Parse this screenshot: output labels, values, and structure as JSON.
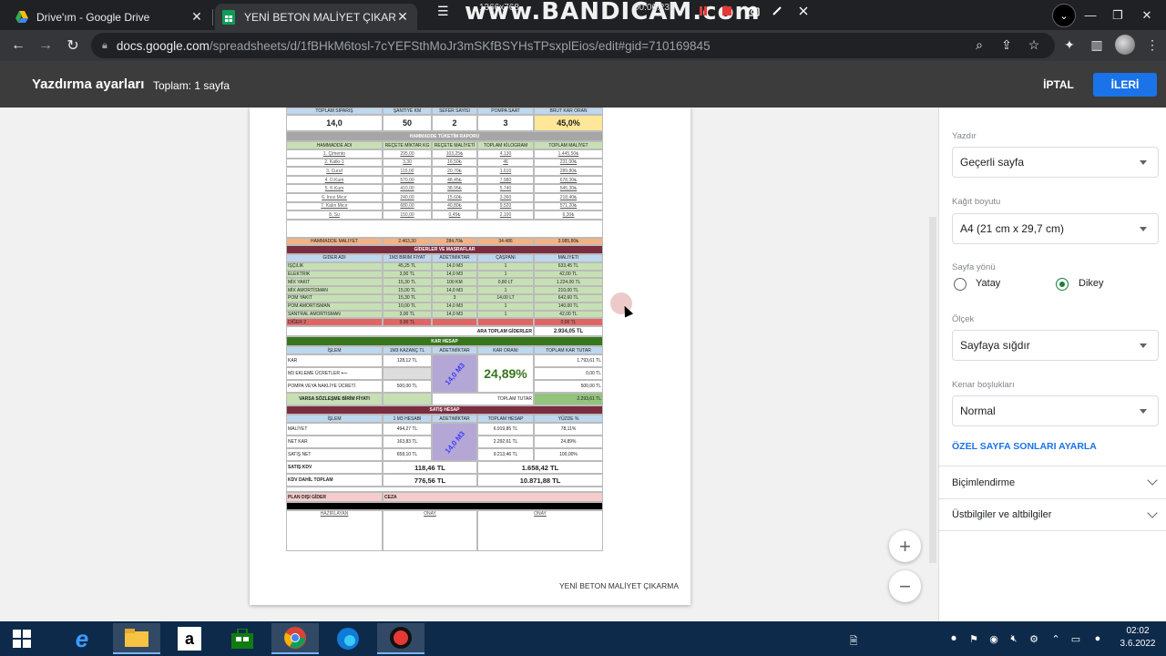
{
  "tabs": [
    {
      "title": "Drive'ım - Google Drive",
      "icon": "google-drive-icon"
    },
    {
      "title": "YENİ BETON MALİYET ÇIKARMA",
      "icon": "google-sheets-icon"
    }
  ],
  "recorder": {
    "logo": "www.BANDICAM.com",
    "resolution": "1366x768",
    "time": "00:06:231"
  },
  "address": {
    "host": "docs.google.com",
    "path": "/spreadsheets/d/1fBHkM6tosl-7cYEFSthMoJr3mSKfBSYHsTPsxplEios/edit#gid=710169845"
  },
  "print": {
    "title": "Yazdırma ayarları",
    "total": "Toplam: 1 sayfa",
    "cancel": "İPTAL",
    "next": "İLERİ"
  },
  "settings": {
    "print_label": "Yazdır",
    "print_value": "Geçerli sayfa",
    "paper_label": "Kağıt boyutu",
    "paper_value": "A4 (21 cm x 29,7 cm)",
    "orientation_label": "Sayfa yönü",
    "landscape": "Yatay",
    "portrait": "Dikey",
    "scale_label": "Ölçek",
    "scale_value": "Sayfaya sığdır",
    "margins_label": "Kenar boşlukları",
    "margins_value": "Normal",
    "custom_breaks": "ÖZEL SAYFA SONLARI AYARLA",
    "formatting": "Biçimlendirme",
    "headers_footers": "Üstbilgiler ve altbilgiler"
  },
  "sheet": {
    "summary_headers": [
      "TOPLAM SİPARİŞ",
      "ŞANTİYE KM",
      "SEFER SAYISI",
      "POMPA SAAT",
      "BRÜT KAR ORAN"
    ],
    "summary_values": [
      "14,0",
      "50",
      "2",
      "3",
      "45,0%"
    ],
    "material_title": "HAMMADDE TÜKETİM RAPORU",
    "material_headers": [
      "HAMMADDE ADI",
      "REÇETE MİKTAR KG",
      "REÇETE MALİYETİ",
      "TOPLAM KİLOGRAM",
      "TOPLAM MALİYET"
    ],
    "materials": [
      [
        "1. Çimento",
        "295,00",
        "103,25₺",
        "4.130",
        "1.445,50₺"
      ],
      [
        "2. Katkı-1",
        "3,30",
        "16,50₺",
        "46",
        "231,00₺"
      ],
      [
        "3. Curuf",
        "115,00",
        "20,70₺",
        "1.610",
        "289,80₺"
      ],
      [
        "4. D.Kum",
        "570,00",
        "48,45₺",
        "7.980",
        "678,30₺"
      ],
      [
        "5. K.Kum",
        "410,00",
        "38,95₺",
        "5.740",
        "545,30₺"
      ],
      [
        "6. Ince Mıcır",
        "240,00",
        "15,60₺",
        "3.360",
        "218,40₺"
      ],
      [
        "7. Kalın Mıcır",
        "680,00",
        "40,80₺",
        "9.520",
        "571,20₺"
      ],
      [
        "8. Su",
        "150,00",
        "0,45₺",
        "2.100",
        "6,30₺"
      ]
    ],
    "material_total": [
      "HAMMADDE MALİYET",
      "2.463,30",
      "284,70₺",
      "34.486",
      "3.985,80₺"
    ],
    "expense_title": "GİDERLER VE MASRAFLAR",
    "expense_headers": [
      "GİDER ADI",
      "1M3 BİRİM FİYAT",
      "ADET/MİKTAR",
      "ÇAŞPANI",
      "MALİYETİ"
    ],
    "expenses": [
      [
        "İŞÇİLİK",
        "45,25 TL",
        "14,0 M3",
        "1",
        "633,45 TL"
      ],
      [
        "ELEKTRİK",
        "3,00 TL",
        "14,0 M3",
        "1",
        "42,00 TL"
      ],
      [
        "MİX YAKIT",
        "15,30 TL",
        "100 KM",
        "0,80 LT",
        "1.224,00 TL"
      ],
      [
        "MİX AMORTİSMAN",
        "15,00 TL",
        "14,0 M3",
        "1",
        "210,00 TL"
      ],
      [
        "POM YAKIT",
        "15,30 TL",
        "3",
        "14,00 LT",
        "642,60 TL"
      ],
      [
        "POM AMORTİSMAN",
        "10,00 TL",
        "14,0 M3",
        "1",
        "140,00 TL"
      ],
      [
        "SANTRAL AMORTİSMAN",
        "3,00 TL",
        "14,0 M3",
        "1",
        "42,00 TL"
      ]
    ],
    "expense_other": [
      "DİĞER 2",
      "0,00 TL",
      "",
      "",
      "0,00 TL"
    ],
    "subtotal_label": "ARA TOPLAM GİDERLER",
    "subtotal_value": "2.934,05 TL",
    "profit_title": "KAR HESAP",
    "profit_headers": [
      "İŞLEM",
      "1M3 KAZANÇ TL",
      "ADET/MİKTAR",
      "KAR ORANI",
      "TOPLAM KAR TUTAR"
    ],
    "profit_rows": [
      [
        "KAR",
        "128,12 TL",
        "1.793,61 TL"
      ],
      [
        "M3 EKLEME ÜCRETLER ⟵",
        "",
        "0,00 TL"
      ],
      [
        "POMPA VEYA NAKLİYE ÜCRETİ",
        "500,00 TL",
        "500,00 TL"
      ]
    ],
    "profit_qty": "14,0 M3",
    "profit_rate": "24,89%",
    "contract_label": "VARSA SÖZLEŞME BİRİM FİYATI",
    "total_amount_label": "TOPLAM TUTAR",
    "total_amount_value": "2.293,61 TL",
    "sales_title": "SATIŞ HESAP",
    "sales_headers": [
      "İŞLEM",
      "1 M3 HESABI",
      "ADET/MİKTAR",
      "TOPLAM HESAP",
      "YÜZDE %"
    ],
    "sales_rows": [
      [
        "MALİYET",
        "494,27 TL",
        "6.919,85 TL",
        "78,11%"
      ],
      [
        "NET KAR",
        "163,83 TL",
        "2.292,61 TL",
        "24,89%"
      ],
      [
        "SATIŞ NET",
        "658,10 TL",
        "9.213,46 TL",
        "100,00%"
      ]
    ],
    "sales_qty": "14,0 M3",
    "vat_label": "SATIŞ KDV",
    "vat_unit": "118,46 TL",
    "vat_total": "1.658,42 TL",
    "vat_incl_label": "KDV DAHİL TOPLAM",
    "vat_incl_unit": "776,56 TL",
    "vat_incl_total": "10.871,88 TL",
    "unplanned_label": "PLAN DIŞI GİDER",
    "penalty_label": "CEZA",
    "signatures": [
      "HAZIRLAYAN",
      "ONAY",
      "ONAY"
    ],
    "footer": "YENİ BETON MALİYET ÇIKARMA"
  },
  "taskbar": {
    "time": "02:02",
    "date": "3.6.2022"
  },
  "colors": {
    "accent": "#1a73e8",
    "dialog_header": "#3c3c3c",
    "taskbar": "#0d2a4a"
  }
}
